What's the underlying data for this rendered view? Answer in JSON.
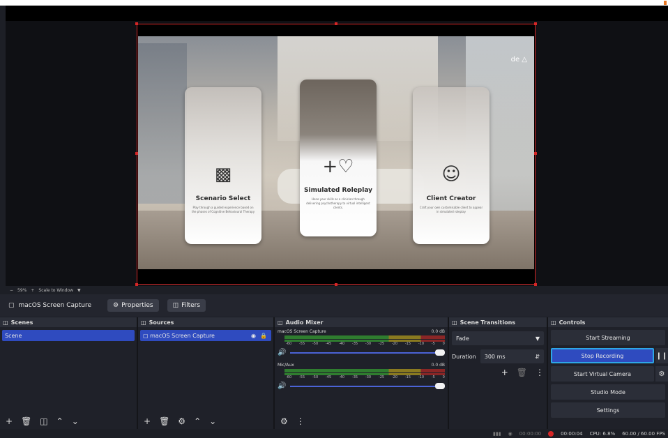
{
  "preview": {
    "logo_text": "de",
    "cards": [
      {
        "title": "Scenario Select",
        "desc": "Play through a guided experience based on the phases of Cognitive Behavioural Therapy",
        "icon": "scenario-icon"
      },
      {
        "title": "Simulated Roleplay",
        "desc": "Hone your skills as a clinician through delivering psychotherapy to virtual intelligent clients.",
        "icon": "plus-heart-icon"
      },
      {
        "title": "Client Creator",
        "desc": "Craft your own customisable client to appear in simulated roleplay",
        "icon": "client-icon"
      }
    ]
  },
  "zoom": {
    "level": "59%",
    "mode": "Scale to Window"
  },
  "source_bar": {
    "source_name": "macOS Screen Capture",
    "properties_label": "Properties",
    "filters_label": "Filters"
  },
  "scenes": {
    "title": "Scenes",
    "items": [
      "Scene"
    ]
  },
  "sources": {
    "title": "Sources",
    "items": [
      "macOS Screen Capture"
    ]
  },
  "mixer": {
    "title": "Audio Mixer",
    "scale": [
      "-60",
      "-55",
      "-50",
      "-45",
      "-40",
      "-35",
      "-30",
      "-25",
      "-20",
      "-15",
      "-10",
      "-5",
      "0"
    ],
    "channels": [
      {
        "name": "macOS Screen Capture",
        "db": "0.0 dB"
      },
      {
        "name": "Mic/Aux",
        "db": "0.0 dB"
      }
    ]
  },
  "transitions": {
    "title": "Scene Transitions",
    "selected": "Fade",
    "duration_label": "Duration",
    "duration_value": "300 ms"
  },
  "controls": {
    "title": "Controls",
    "start_streaming": "Start Streaming",
    "stop_recording": "Stop Recording",
    "start_virtual_camera": "Start Virtual Camera",
    "studio_mode": "Studio Mode",
    "settings": "Settings"
  },
  "status": {
    "stream_time": "00:00:00",
    "rec_time": "00:00:04",
    "cpu": "CPU: 6.8%",
    "fps": "60.00 / 60.00 FPS"
  },
  "colors": {
    "accent": "#2f4bbf",
    "record": "#d62626",
    "border_highlight": "#2ea6e6"
  }
}
